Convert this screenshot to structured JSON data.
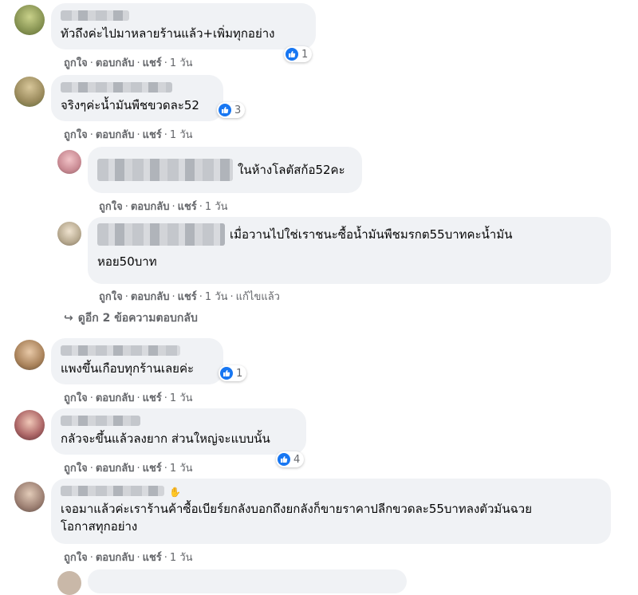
{
  "actions": {
    "like": "ถูกใจ",
    "reply": "ตอบกลับ",
    "share": "แชร์",
    "time": "1 วัน",
    "edited": "แก้ไขแล้ว",
    "sep": "·"
  },
  "comments": [
    {
      "text": "ทัวถึงค่ะไปมาหลายร้านแล้ว+เพิ่มทุกอย่าง",
      "reactions": "1"
    },
    {
      "text": "จริงๆค่ะน้ำมันพืชขวดละ52",
      "reactions": "3"
    },
    {
      "text": "ในห้างโลตัสก้อ52คะ"
    },
    {
      "text_line1": "เมื่อวานไปใช่เราชนะซื้อน้ำมันพืชมรกต55บาทคะน้ำมัน",
      "text_line2": "หอย50บาท"
    },
    {
      "text": "แพงขึ้นเกือบทุกร้านเลยค่ะ",
      "reactions": "1"
    },
    {
      "text": "กลัวจะขึ้นแล้วลงยาก ส่วนใหญ่จะแบบนั้น",
      "reactions": "4"
    },
    {
      "text_line1": "เจอมาแล้วค่ะเราร้านค้าซื้อเบียร์ยกลังบอกถึงยกลังก็ขายราคาปลีกขวดละ55บาทลงตัวมันฉวย",
      "text_line2": "โอกาสทุกอย่าง"
    }
  ],
  "more_replies": "ดูอีก 2 ข้อความตอบกลับ",
  "colors": {
    "bubble": "#f0f2f5",
    "like_blue": "#1877f2",
    "meta_gray": "#65676b"
  }
}
